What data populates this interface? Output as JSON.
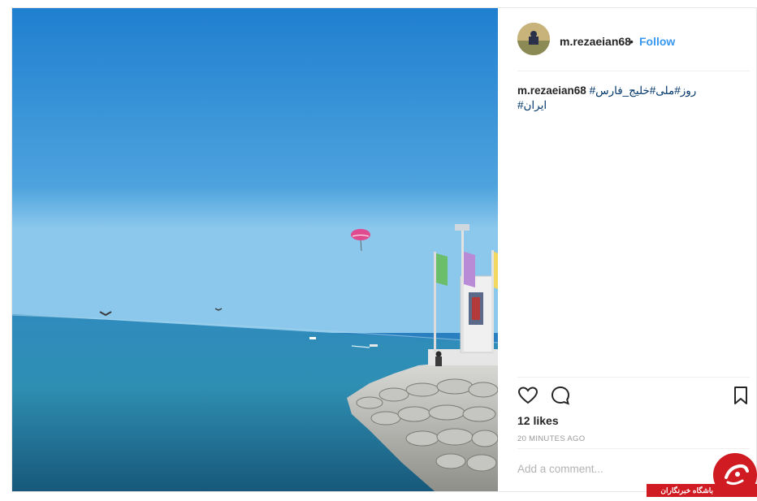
{
  "post": {
    "username": "m.rezaeian68",
    "separator": "•",
    "follow_label": "Follow",
    "caption": {
      "user": "m.rezaeian68",
      "tags_line1": "#روز#ملی#خلیج_فارس",
      "tags_line2": "#ایران"
    },
    "likes": "12 likes",
    "timestamp": "20 MINUTES AGO",
    "comment_placeholder": "Add a comment..."
  },
  "watermark": {
    "text": "باشگاه خبرنگاران"
  },
  "icons": [
    "heart-icon",
    "comment-icon",
    "bookmark-icon"
  ],
  "colors": {
    "link": "#3897f0",
    "hashtag": "#003569",
    "watermark": "#d01b22"
  }
}
